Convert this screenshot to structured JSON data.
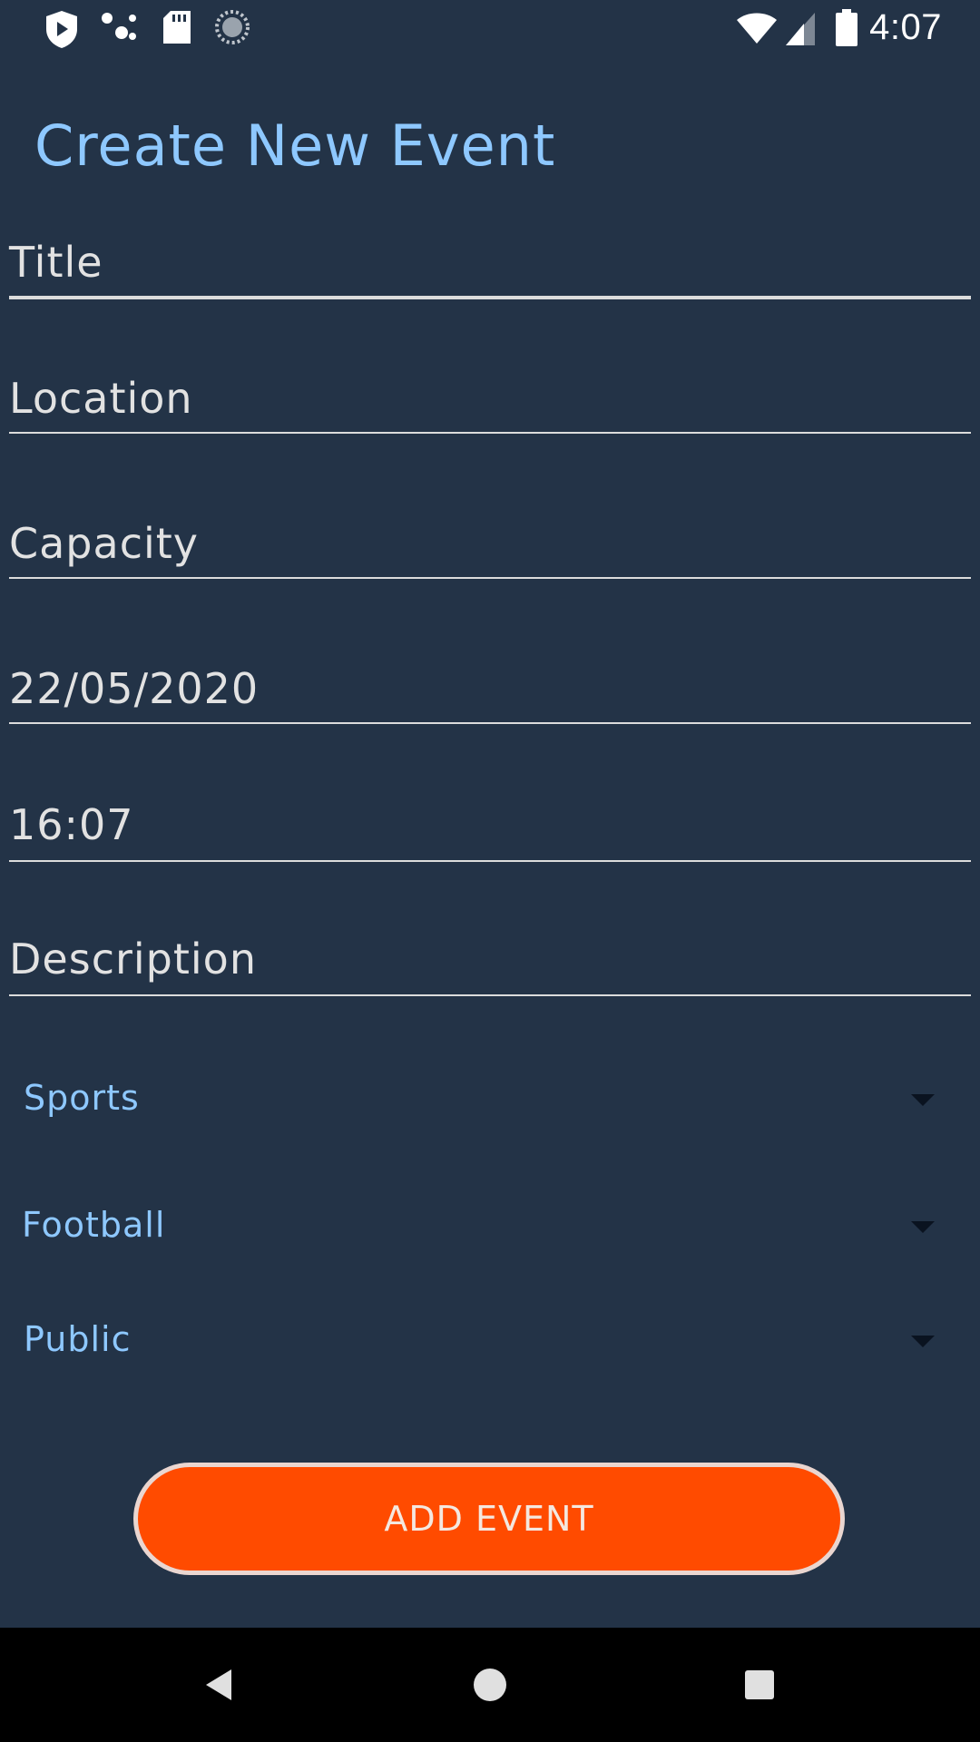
{
  "status_bar": {
    "time": "4:07",
    "left_icons": [
      "shield-icon",
      "dots-icon",
      "sd-card-icon",
      "sync-icon"
    ],
    "right_icons": [
      "wifi-icon",
      "signal-icon",
      "battery-icon"
    ]
  },
  "page": {
    "title": "Create New Event"
  },
  "form": {
    "title_placeholder": "Title",
    "location_placeholder": "Location",
    "capacity_placeholder": "Capacity",
    "date_value": "22/05/2020",
    "time_value": "16:07",
    "description_placeholder": "Description"
  },
  "dropdowns": {
    "category": "Sports",
    "sport": "Football",
    "visibility": "Public"
  },
  "actions": {
    "add_event_label": "ADD EVENT"
  },
  "colors": {
    "background": "#233347",
    "accent": "#8ec8ff",
    "button": "#ff4b00",
    "nav_bar": "#000000"
  },
  "nav": {
    "icons": [
      "back-icon",
      "home-icon",
      "recents-icon"
    ]
  }
}
